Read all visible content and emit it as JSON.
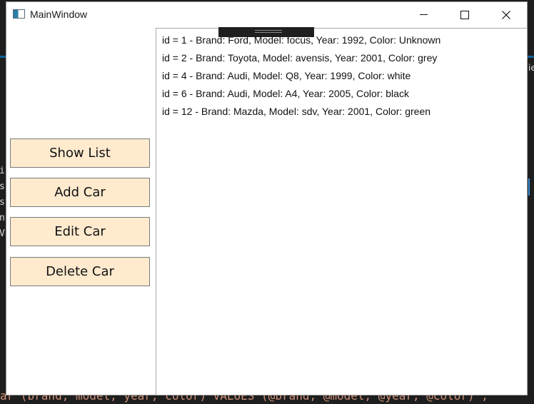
{
  "window": {
    "title": "MainWindow",
    "controls": [
      "minimize",
      "maximize",
      "close"
    ]
  },
  "buttons": {
    "show_list": "Show List",
    "add_car": "Add Car",
    "edit_car": "Edit Car",
    "delete_car": "Delete Car"
  },
  "cars": [
    "id = 1 - Brand: Ford, Model: focus, Year: 1992, Color: Unknown",
    "id = 2 - Brand: Toyota, Model: avensis, Year: 2001, Color: grey",
    "id = 4 - Brand: Audi, Model: Q8, Year: 1999, Color: white",
    "id = 6 - Brand: Audi, Model: A4, Year: 2005, Color: black",
    "id = 12 - Brand: Mazda, Model: sdv, Year: 2001, Color: green"
  ],
  "background": {
    "code_bottom": "ar (brand, model, year, color) VALUES (@brand, @model, @year, @color)\";",
    "code_left": [
      "in",
      "si",
      "st",
      "nt",
      "Va"
    ],
    "code_right": "ie"
  },
  "colors": {
    "button_fill": "#ffeace",
    "ide_background": "#1e1e1e"
  }
}
